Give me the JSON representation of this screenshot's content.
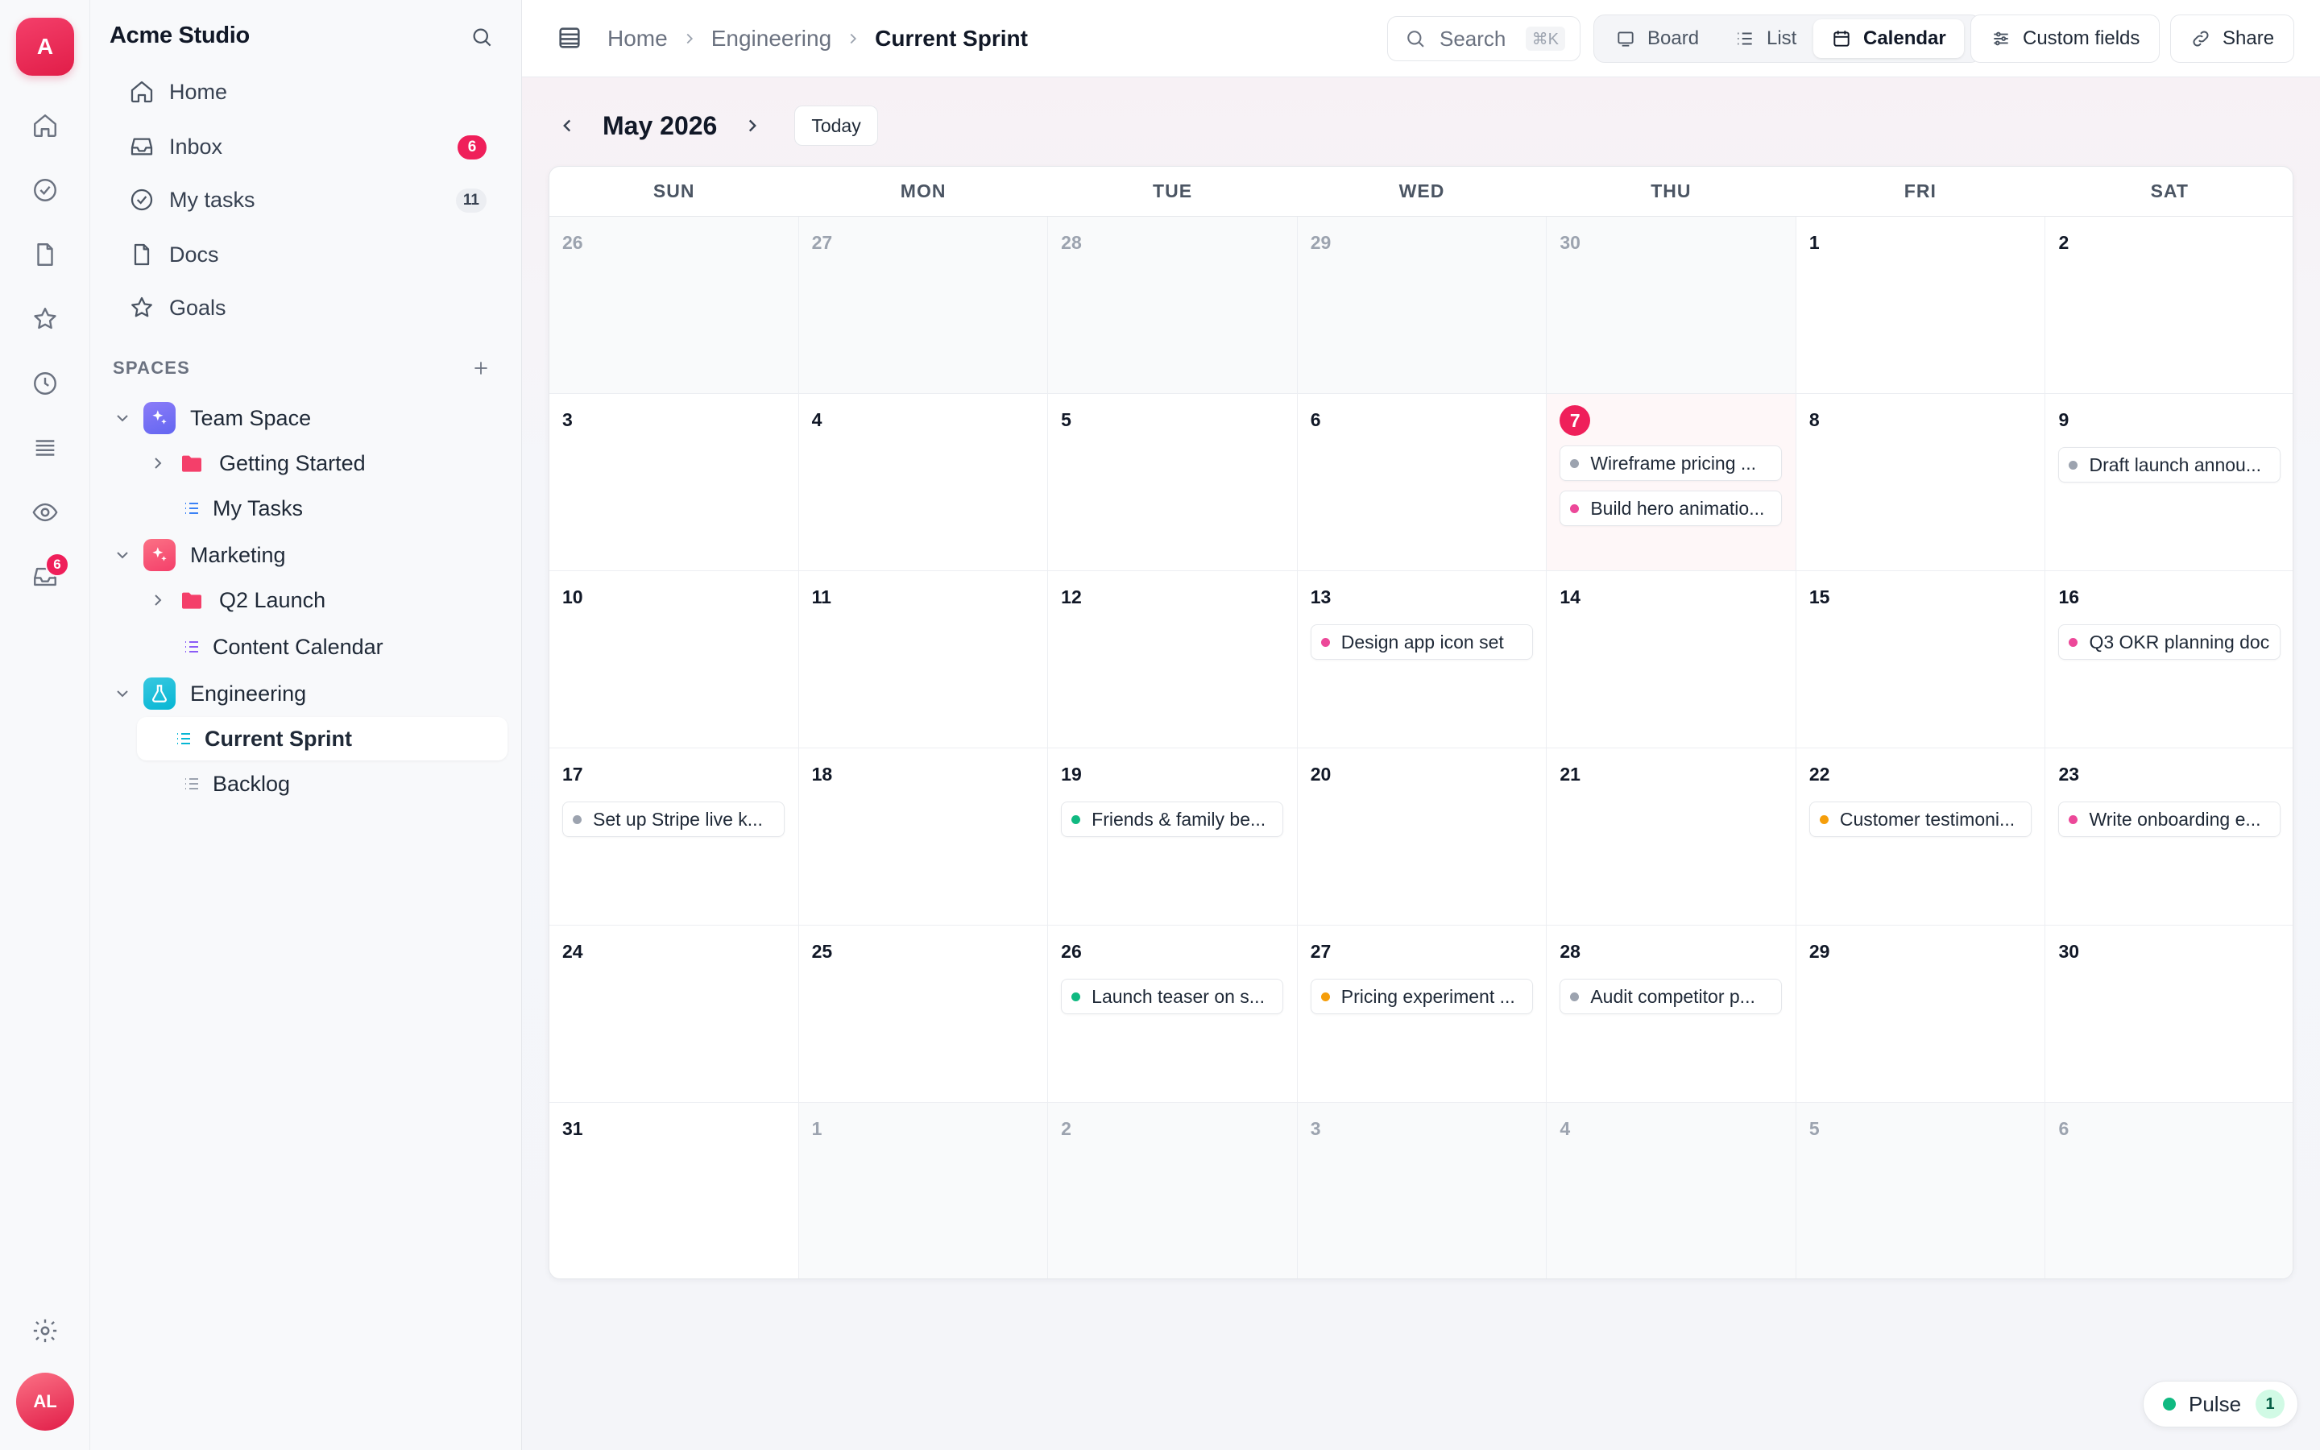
{
  "workspace": {
    "initial": "A",
    "name": "Acme Studio",
    "user_initials": "AL"
  },
  "rail": {
    "inbox_badge": "6"
  },
  "nav": [
    {
      "label": "Home",
      "icon": "home-icon"
    },
    {
      "label": "Inbox",
      "icon": "inbox-icon",
      "count": "6"
    },
    {
      "label": "My tasks",
      "icon": "check-circle-icon",
      "count": "11"
    },
    {
      "label": "Docs",
      "icon": "doc-icon"
    },
    {
      "label": "Goals",
      "icon": "star-icon"
    }
  ],
  "spaces": {
    "label": "SPACES",
    "items": [
      {
        "name": "Team Space",
        "color": "#7c6cf6"
      },
      {
        "name": "Getting Started",
        "kind": "folder"
      },
      {
        "name": "My Tasks",
        "kind": "list"
      },
      {
        "name": "Marketing",
        "color": "#f4517a"
      },
      {
        "name": "Q2 Launch",
        "kind": "folder"
      },
      {
        "name": "Content Calendar",
        "kind": "list"
      },
      {
        "name": "Engineering",
        "color": "#22b8cf"
      },
      {
        "name": "Current Sprint",
        "kind": "list",
        "active": true
      },
      {
        "name": "Backlog",
        "kind": "list"
      }
    ]
  },
  "breadcrumb": [
    "Home",
    "Engineering",
    "Current Sprint"
  ],
  "search": {
    "placeholder": "Search",
    "shortcut": "⌘K"
  },
  "views": [
    "Board",
    "List",
    "Calendar"
  ],
  "active_view": "Calendar",
  "toolbar": {
    "custom_fields": "Custom fields",
    "share": "Share"
  },
  "calendar": {
    "month": "May 2026",
    "today_label": "Today",
    "weekdays": [
      "SUN",
      "MON",
      "TUE",
      "WED",
      "THU",
      "FRI",
      "SAT"
    ],
    "status_colors": {
      "todo": "#9ca3af",
      "urgent": "#ec4899",
      "done": "#10b981",
      "in_progress": "#f59e0b"
    },
    "weeks": [
      [
        {
          "d": "26",
          "muted": true
        },
        {
          "d": "27",
          "muted": true
        },
        {
          "d": "28",
          "muted": true
        },
        {
          "d": "29",
          "muted": true
        },
        {
          "d": "30",
          "muted": true
        },
        {
          "d": "1"
        },
        {
          "d": "2"
        }
      ],
      [
        {
          "d": "3"
        },
        {
          "d": "4"
        },
        {
          "d": "5"
        },
        {
          "d": "6"
        },
        {
          "d": "7",
          "today": true,
          "events": [
            {
              "t": "Wireframe pricing ...",
              "c": "#9ca3af"
            },
            {
              "t": "Build hero animatio...",
              "c": "#ec4899"
            }
          ]
        },
        {
          "d": "8"
        },
        {
          "d": "9",
          "events": [
            {
              "t": "Draft launch annou...",
              "c": "#9ca3af"
            }
          ]
        }
      ],
      [
        {
          "d": "10"
        },
        {
          "d": "11"
        },
        {
          "d": "12"
        },
        {
          "d": "13",
          "events": [
            {
              "t": "Design app icon set",
              "c": "#ec4899"
            }
          ]
        },
        {
          "d": "14"
        },
        {
          "d": "15"
        },
        {
          "d": "16",
          "events": [
            {
              "t": "Q3 OKR planning doc",
              "c": "#ec4899"
            }
          ]
        }
      ],
      [
        {
          "d": "17",
          "events": [
            {
              "t": "Set up Stripe live k...",
              "c": "#9ca3af"
            }
          ]
        },
        {
          "d": "18"
        },
        {
          "d": "19",
          "events": [
            {
              "t": "Friends & family be...",
              "c": "#10b981"
            }
          ]
        },
        {
          "d": "20"
        },
        {
          "d": "21"
        },
        {
          "d": "22",
          "events": [
            {
              "t": "Customer testimoni...",
              "c": "#f59e0b"
            }
          ]
        },
        {
          "d": "23",
          "events": [
            {
              "t": "Write onboarding e...",
              "c": "#ec4899"
            }
          ]
        }
      ],
      [
        {
          "d": "24"
        },
        {
          "d": "25"
        },
        {
          "d": "26",
          "events": [
            {
              "t": "Launch teaser on s...",
              "c": "#10b981"
            }
          ]
        },
        {
          "d": "27",
          "events": [
            {
              "t": "Pricing experiment ...",
              "c": "#f59e0b"
            }
          ]
        },
        {
          "d": "28",
          "events": [
            {
              "t": "Audit competitor p...",
              "c": "#9ca3af"
            }
          ]
        },
        {
          "d": "29"
        },
        {
          "d": "30"
        }
      ],
      [
        {
          "d": "31"
        },
        {
          "d": "1",
          "muted": true
        },
        {
          "d": "2",
          "muted": true
        },
        {
          "d": "3",
          "muted": true
        },
        {
          "d": "4",
          "muted": true
        },
        {
          "d": "5",
          "muted": true
        },
        {
          "d": "6",
          "muted": true
        }
      ]
    ]
  },
  "pulse": {
    "label": "Pulse",
    "count": "1"
  }
}
